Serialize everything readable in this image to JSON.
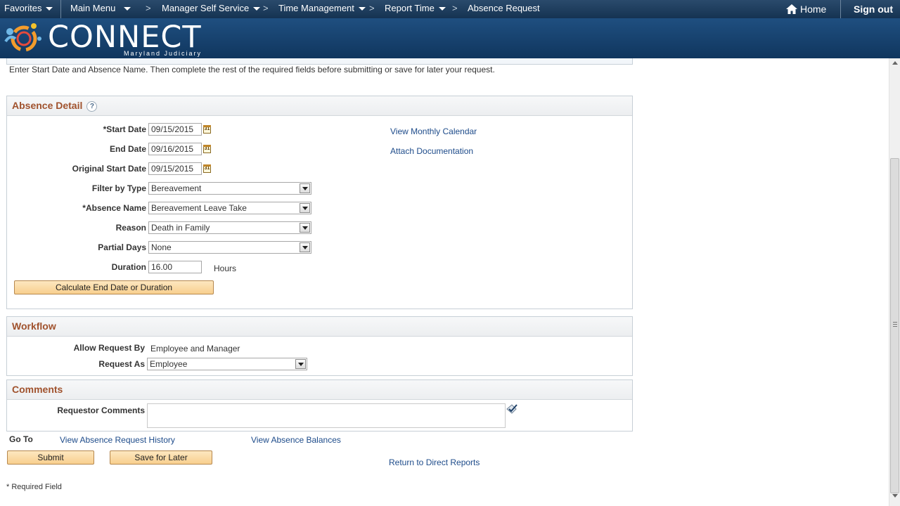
{
  "nav": {
    "favorites": "Favorites",
    "main_menu": "Main Menu",
    "crumbs": [
      "Manager Self Service",
      "Time Management",
      "Report Time",
      "Absence Request"
    ],
    "separator": ">",
    "home": "Home",
    "signout": "Sign out"
  },
  "brand": {
    "name": "CONNECT",
    "subtitle": "Maryland Judiciary"
  },
  "intro": {
    "text": "Enter Start Date and Absence Name. Then complete the rest of the required fields before submitting or save for later your request."
  },
  "absence_detail": {
    "title": "Absence Detail",
    "help": "?",
    "start_date_label": "*Start Date",
    "start_date": "09/15/2015",
    "end_date_label": "End Date",
    "end_date": "09/16/2015",
    "original_start_label": "Original Start Date",
    "original_start": "09/15/2015",
    "calendar_glyph": "31",
    "filter_label": "Filter by Type",
    "filter_value": "Bereavement",
    "absence_name_label": "*Absence Name",
    "absence_name_value": "Bereavement Leave Take",
    "reason_label": "Reason",
    "reason_value": "Death in Family",
    "partial_label": "Partial Days",
    "partial_value": "None",
    "duration_label": "Duration",
    "duration_value": "16.00",
    "duration_unit": "Hours",
    "calc_button": "Calculate End Date or Duration",
    "view_calendar_link": "View Monthly Calendar",
    "attach_link": "Attach Documentation"
  },
  "workflow": {
    "title": "Workflow",
    "allow_label": "Allow Request By",
    "allow_value": "Employee and Manager",
    "request_as_label": "Request As",
    "request_as_value": "Employee"
  },
  "comments": {
    "title": "Comments",
    "requestor_label": "Requestor Comments",
    "requestor_value": ""
  },
  "goto": {
    "label": "Go To",
    "history_link": "View Absence Request History",
    "balances_link": "View Absence Balances"
  },
  "actions": {
    "submit": "Submit",
    "save_later": "Save for Later",
    "return_link": "Return to Direct Reports"
  },
  "footer": {
    "required_note": "* Required Field"
  }
}
